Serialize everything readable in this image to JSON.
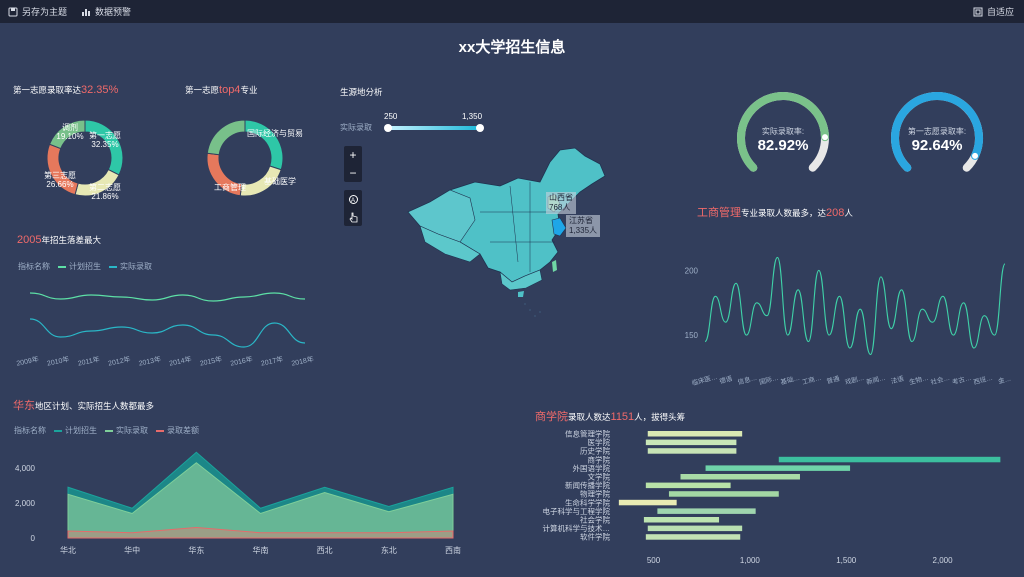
{
  "toolbar": {
    "save_theme": "另存为主题",
    "data_alert": "数据预警",
    "adapt": "自适应"
  },
  "title": "xx大学招生信息",
  "donut1": {
    "title_prefix": "第一志愿录取率达",
    "title_value": "32.35%",
    "slices": [
      {
        "name": "第一志愿",
        "pct": "32.35%",
        "value": 32.35,
        "color": "#2ec7a7"
      },
      {
        "name": "第二志愿",
        "pct": "21.86%",
        "value": 21.86,
        "color": "#e7e8b4"
      },
      {
        "name": "第三志愿",
        "pct": "26.66%",
        "value": 26.66,
        "color": "#e6785c"
      },
      {
        "name": "调剂",
        "pct": "19.10%",
        "value": 19.1,
        "color": "#78c08a"
      }
    ]
  },
  "donut2": {
    "title_prefix": "第一志愿",
    "title_value": "top4",
    "title_suffix": "专业",
    "slices": [
      {
        "name": "国际经济与贸易",
        "value": 30,
        "color": "#2ec7a7"
      },
      {
        "name": "基础医学",
        "value": 22,
        "color": "#e7e8b4"
      },
      {
        "name": "工商管理",
        "value": 25,
        "color": "#e6785c"
      },
      {
        "name": "",
        "value": 23,
        "color": "#78c08a"
      }
    ]
  },
  "map": {
    "title": "生源地分析",
    "range_label": "实际录取",
    "range_min": "250",
    "range_max": "1,350",
    "tips": [
      {
        "name": "山西省",
        "value": "768人"
      },
      {
        "name": "江苏省",
        "value": "1,335人"
      }
    ],
    "controls": [
      "+",
      "−"
    ]
  },
  "gauges": [
    {
      "label": "实际录取率:",
      "value": "82.92%",
      "pct": 0.8292,
      "color": "#7ac28a"
    },
    {
      "label": "第一志愿录取率:",
      "value": "92.64%",
      "pct": 0.9264,
      "color": "#2aa6e0"
    }
  ],
  "line_top": {
    "title_value": "2005",
    "title_suffix": "年招生落差最大",
    "legend_label": "指标名称",
    "legend": [
      {
        "name": "计划招生",
        "color": "#5de0a6"
      },
      {
        "name": "实际录取",
        "color": "#2ab7c7"
      }
    ],
    "years": [
      "2009年",
      "2010年",
      "2011年",
      "2012年",
      "2013年",
      "2014年",
      "2015年",
      "2016年",
      "2017年",
      "2018年"
    ]
  },
  "major_line": {
    "title_value": "工商管理",
    "title_mid": "专业录取人数最多，达",
    "title_num": "208",
    "title_suffix": "人",
    "y_ticks": [
      "200",
      "150"
    ],
    "categories": [
      "临床医…",
      "德语",
      "信息…",
      "国际…",
      "基础…",
      "工商…",
      "普通",
      "戏剧…",
      "新闻…",
      "法语",
      "生物…",
      "社会…",
      "考古…",
      "西班…",
      "金…"
    ]
  },
  "area": {
    "title_value": "华东",
    "title_suffix": "地区计划、实际招生人数都最多",
    "legend_label": "指标名称",
    "legend": [
      {
        "name": "计划招生",
        "color": "#1ba39c"
      },
      {
        "name": "实际录取",
        "color": "#7fcf9a"
      },
      {
        "name": "录取差额",
        "color": "#e66b6b"
      }
    ],
    "y_ticks": [
      "4,000",
      "2,000",
      "0"
    ],
    "regions": [
      "华北",
      "华中",
      "华东",
      "华南",
      "西北",
      "东北",
      "西南"
    ]
  },
  "bar": {
    "title_value": "商学院",
    "title_mid": "录取人数达",
    "title_num": "1151",
    "title_suffix": "人，拔得头筹",
    "x_ticks": [
      "500",
      "1,000",
      "1,500",
      "2,000"
    ],
    "colleges": [
      "信息管理学院",
      "医学院",
      "历史学院",
      "商学院",
      "外国语学院",
      "文学院",
      "新闻传播学院",
      "物理学院",
      "生命科学学院",
      "电子科学与工程学院",
      "社会学院",
      "计算机科学与技术…",
      "软件学院"
    ]
  },
  "chart_data": [
    {
      "type": "pie",
      "title": "第一志愿录取率达32.35%",
      "categories": [
        "第一志愿",
        "第二志愿",
        "第三志愿",
        "调剂"
      ],
      "values": [
        32.35,
        21.86,
        26.66,
        19.1
      ]
    },
    {
      "type": "line",
      "title": "2005年招生落差最大",
      "categories": [
        "2009年",
        "2010年",
        "2011年",
        "2012年",
        "2013年",
        "2014年",
        "2015年",
        "2016年",
        "2017年",
        "2018年"
      ],
      "series": [
        {
          "name": "计划招生",
          "values": [
            62,
            56,
            60,
            58,
            55,
            60,
            54,
            58,
            62,
            56
          ]
        },
        {
          "name": "实际录取",
          "values": [
            36,
            18,
            24,
            28,
            22,
            30,
            20,
            8,
            32,
            12
          ]
        }
      ]
    },
    {
      "type": "line",
      "title": "工商管理专业录取人数最多，达208人",
      "ylim": [
        130,
        215
      ],
      "series": [
        {
          "name": "",
          "values": [
            145,
            180,
            160,
            190,
            150,
            175,
            165,
            210,
            150,
            185,
            145,
            200,
            150,
            180,
            140,
            170,
            135,
            195,
            155,
            185,
            145,
            170,
            160,
            180,
            150,
            175,
            140,
            165,
            150,
            205
          ]
        }
      ]
    },
    {
      "type": "area",
      "title": "华东地区计划、实际招生人数都最多",
      "categories": [
        "华北",
        "华中",
        "华东",
        "华南",
        "西北",
        "东北",
        "西南"
      ],
      "ylim": [
        0,
        5000
      ],
      "series": [
        {
          "name": "计划招生",
          "values": [
            2900,
            1700,
            4900,
            1700,
            2900,
            1800,
            2900
          ]
        },
        {
          "name": "实际录取",
          "values": [
            2500,
            1400,
            4300,
            1400,
            2600,
            1500,
            2500
          ]
        },
        {
          "name": "录取差额",
          "values": [
            400,
            300,
            600,
            300,
            300,
            300,
            400
          ]
        }
      ]
    },
    {
      "type": "bar",
      "title": "商学院录取人数达1151人，拔得头筹",
      "categories": [
        "信息管理学院",
        "医学院",
        "历史学院",
        "商学院",
        "外国语学院",
        "文学院",
        "新闻传播学院",
        "物理学院",
        "生命科学学院",
        "电子科学与工程学院",
        "社会学院",
        "计算机科学与技术…",
        "软件学院"
      ],
      "series": [
        {
          "name": "start",
          "values": [
            470,
            460,
            470,
            1150,
            770,
            640,
            460,
            580,
            320,
            520,
            450,
            470,
            460
          ]
        },
        {
          "name": "end",
          "values": [
            960,
            930,
            930,
            2300,
            1520,
            1260,
            900,
            1150,
            620,
            1030,
            840,
            960,
            950
          ]
        }
      ],
      "xlim": [
        300,
        2350
      ]
    }
  ]
}
